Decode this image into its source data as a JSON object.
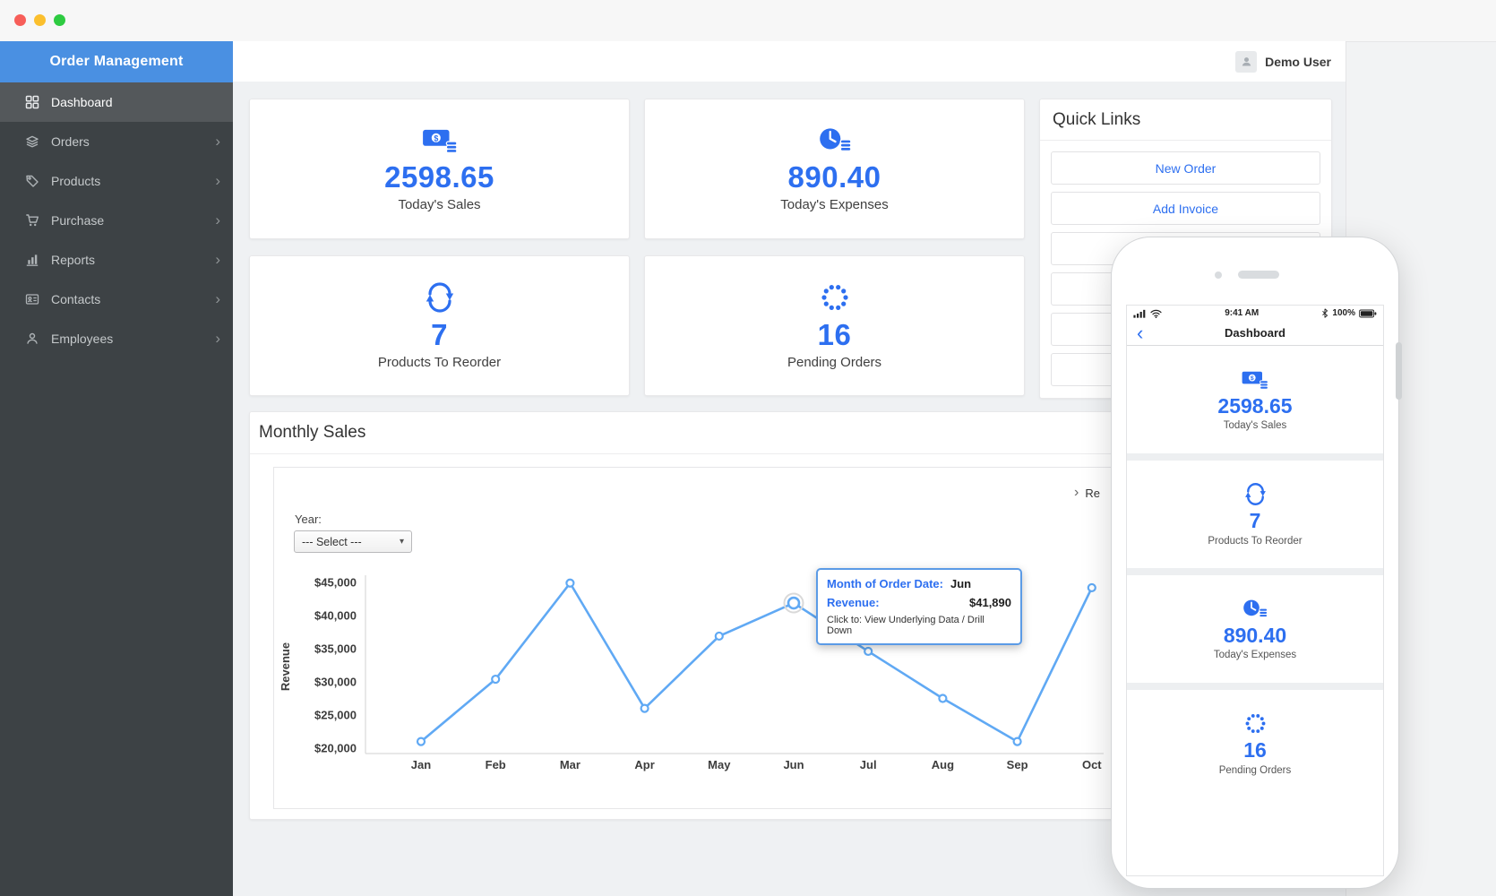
{
  "colors": {
    "accent": "#2d6ff0",
    "header_blue": "#4a90e2",
    "sidebar_bg": "#3d4245",
    "chart_line": "#60a9f4"
  },
  "sidebar": {
    "title": "Order Management",
    "items": [
      {
        "label": "Dashboard",
        "active": true
      },
      {
        "label": "Orders"
      },
      {
        "label": "Products"
      },
      {
        "label": "Purchase"
      },
      {
        "label": "Reports"
      },
      {
        "label": "Contacts"
      },
      {
        "label": "Employees"
      }
    ]
  },
  "topbar": {
    "user_name": "Demo User"
  },
  "stats": [
    {
      "icon": "sales-icon",
      "value": "2598.65",
      "label": "Today's Sales"
    },
    {
      "icon": "expenses-icon",
      "value": "890.40",
      "label": "Today's Expenses"
    },
    {
      "icon": "reorder-icon",
      "value": "7",
      "label": "Products To Reorder"
    },
    {
      "icon": "pending-icon",
      "value": "16",
      "label": "Pending Orders"
    }
  ],
  "quick_links": {
    "title": "Quick Links",
    "links": [
      "New Order",
      "Add Invoice"
    ]
  },
  "monthly_sales": {
    "title": "Monthly Sales",
    "year_label": "Year:",
    "year_value": "--- Select ---",
    "legend_partial": "Re",
    "tooltip": {
      "month_label": "Month of Order Date:",
      "month_value": "Jun",
      "revenue_label": "Revenue:",
      "revenue_value": "$41,890",
      "hint": "Click to: View Underlying Data / Drill Down"
    }
  },
  "chart_data": {
    "type": "line",
    "title": "Monthly Sales",
    "x": [
      "Jan",
      "Feb",
      "Mar",
      "Apr",
      "May",
      "Jun",
      "Jul",
      "Aug",
      "Sep",
      "Oct"
    ],
    "series": [
      {
        "name": "Revenue",
        "values": [
          21000,
          30400,
          44900,
          26000,
          36900,
          41890,
          34600,
          27500,
          21000,
          44200
        ]
      }
    ],
    "ylabel": "Revenue",
    "ylim": [
      20000,
      45000
    ],
    "yticks": [
      20000,
      25000,
      30000,
      35000,
      40000,
      45000
    ],
    "grid": false,
    "highlight_index": 5
  },
  "phone": {
    "time": "9:41 AM",
    "battery_percent": "100%",
    "title": "Dashboard",
    "cards": [
      {
        "icon": "sales-icon",
        "value": "2598.65",
        "label": "Today's Sales"
      },
      {
        "icon": "reorder-icon",
        "value": "7",
        "label": "Products To Reorder"
      },
      {
        "icon": "expenses-icon",
        "value": "890.40",
        "label": "Today's Expenses"
      },
      {
        "icon": "pending-icon",
        "value": "16",
        "label": "Pending Orders"
      }
    ]
  }
}
